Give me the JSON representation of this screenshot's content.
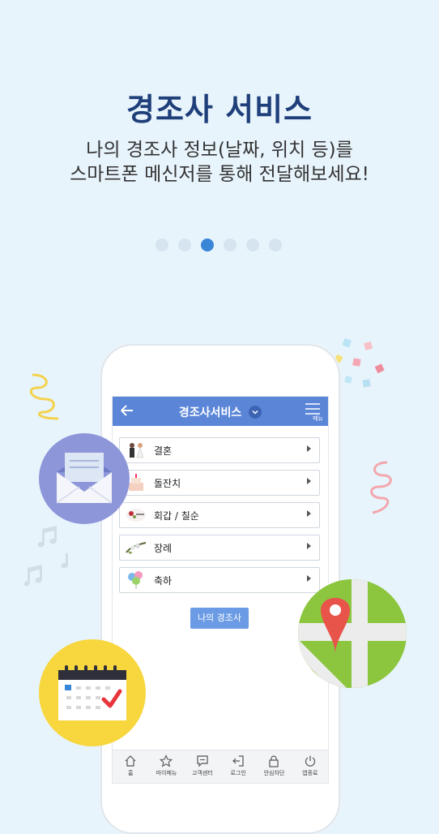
{
  "header": {
    "title": "경조사 서비스",
    "subtitle_line1": "나의 경조사 정보(날짜, 위치 등)를",
    "subtitle_line2": "스마트폰 메신저를 통해 전달해보세요!"
  },
  "pager": {
    "total": 6,
    "active_index": 2
  },
  "app": {
    "title": "경조사서비스",
    "menu_label": "메뉴",
    "items": [
      {
        "label": "결혼",
        "icon": "wedding-couple-icon"
      },
      {
        "label": "돌잔치",
        "icon": "birthday-cake-icon"
      },
      {
        "label": "회갑 / 칠순",
        "icon": "flower-card-icon"
      },
      {
        "label": "장례",
        "icon": "funeral-flower-icon"
      },
      {
        "label": "축하",
        "icon": "balloons-icon"
      }
    ],
    "my_button": "나의 경조사",
    "nav": [
      {
        "label": "홈",
        "icon": "home-icon"
      },
      {
        "label": "마이메뉴",
        "icon": "star-icon"
      },
      {
        "label": "고객센터",
        "icon": "chat-icon"
      },
      {
        "label": "로그인",
        "icon": "login-icon"
      },
      {
        "label": "안심차단",
        "icon": "lock-icon"
      },
      {
        "label": "앱종료",
        "icon": "power-icon"
      }
    ]
  },
  "colors": {
    "background": "#e8f4fc",
    "title": "#1f3f7a",
    "header_bar": "#5b86d8",
    "dot_active": "#3a86d6",
    "mail_circle": "#8d96d9",
    "calendar_circle": "#f8d63e",
    "map_green": "#8cc63f",
    "map_pin": "#e8534a"
  }
}
